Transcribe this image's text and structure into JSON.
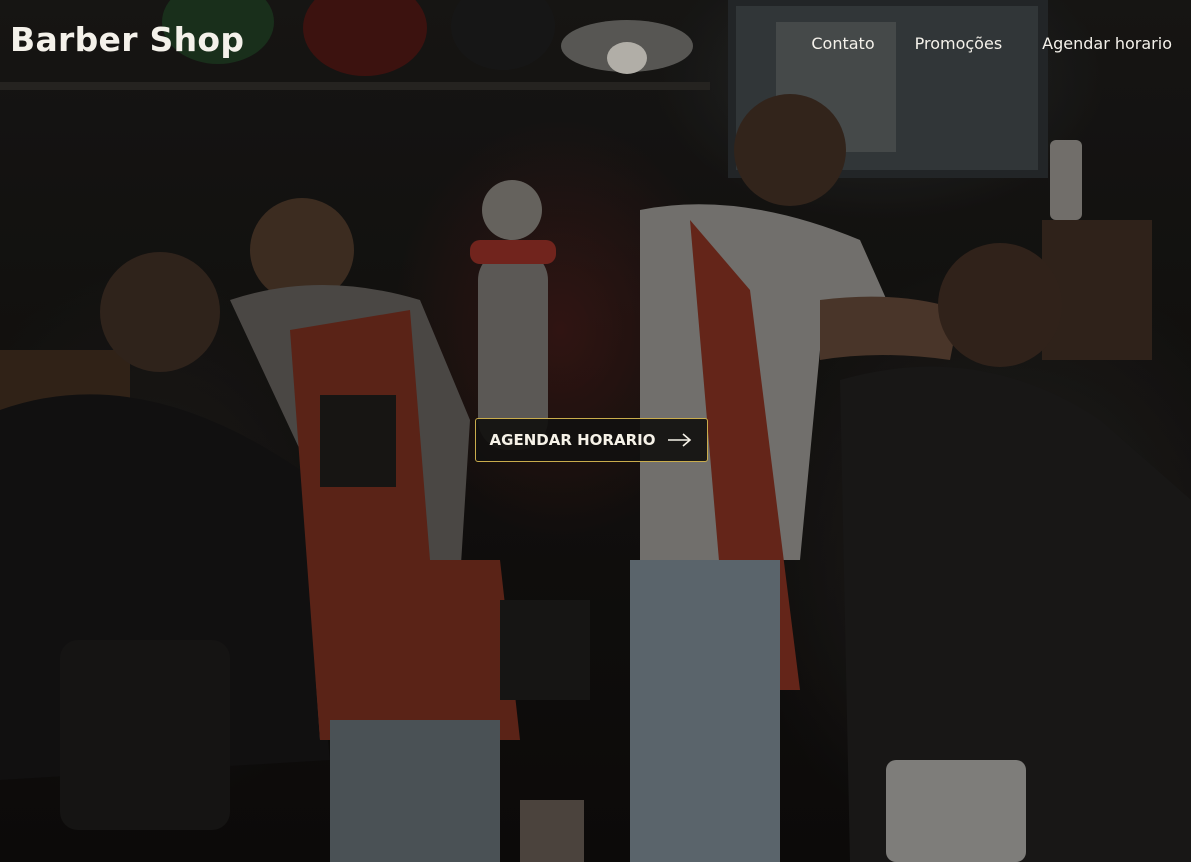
{
  "header": {
    "brand": "Barber Shop",
    "nav": [
      {
        "label": "Contato"
      },
      {
        "label": "Promoções"
      },
      {
        "label": "Agendar horario"
      }
    ]
  },
  "hero": {
    "background": "barbershop-photo",
    "cta_label": "AGENDAR HORARIO",
    "cta_icon": "arrow-right-icon"
  },
  "colors": {
    "text": "#f4f1ea",
    "cta_border": "#c9ac4c",
    "cta_background": "#11100f"
  }
}
